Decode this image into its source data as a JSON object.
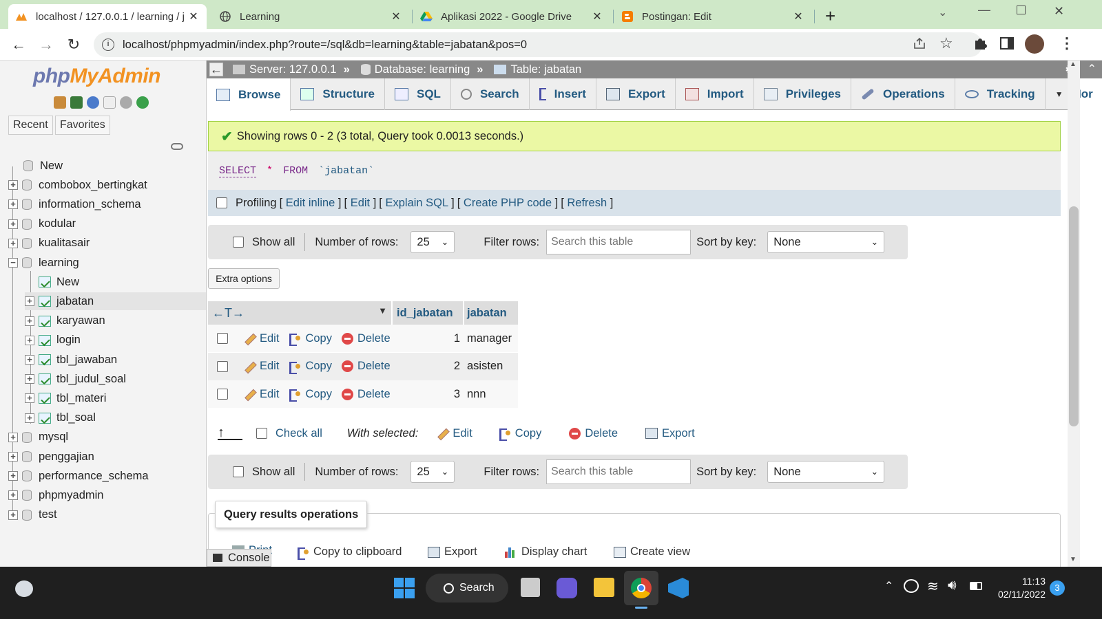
{
  "browser": {
    "tabs": [
      {
        "title": "localhost / 127.0.0.1 / learning / j",
        "active": true
      },
      {
        "title": "Learning",
        "active": false
      },
      {
        "title": "Aplikasi 2022 - Google Drive",
        "active": false
      },
      {
        "title": "Postingan: Edit",
        "active": false
      }
    ],
    "new_tab": "+",
    "url": "localhost/phpmyadmin/index.php?route=/sql&db=learning&table=jabatan&pos=0"
  },
  "sidebar": {
    "logo_php": "php",
    "logo_my": "MyAdmin",
    "recent": "Recent",
    "favorites": "Favorites",
    "tree": [
      {
        "label": "New",
        "type": "new",
        "level": 0
      },
      {
        "label": "combobox_bertingkat",
        "type": "db",
        "level": 0
      },
      {
        "label": "information_schema",
        "type": "db",
        "level": 0
      },
      {
        "label": "kodular",
        "type": "db",
        "level": 0
      },
      {
        "label": "kualitasair",
        "type": "db",
        "level": 0
      },
      {
        "label": "learning",
        "type": "db-open",
        "level": 0
      },
      {
        "label": "New",
        "type": "new",
        "level": 1
      },
      {
        "label": "jabatan",
        "type": "table",
        "level": 1,
        "selected": true
      },
      {
        "label": "karyawan",
        "type": "table",
        "level": 1
      },
      {
        "label": "login",
        "type": "table",
        "level": 1
      },
      {
        "label": "tbl_jawaban",
        "type": "table",
        "level": 1
      },
      {
        "label": "tbl_judul_soal",
        "type": "table",
        "level": 1
      },
      {
        "label": "tbl_materi",
        "type": "table",
        "level": 1
      },
      {
        "label": "tbl_soal",
        "type": "table",
        "level": 1
      },
      {
        "label": "mysql",
        "type": "db",
        "level": 0
      },
      {
        "label": "penggajian",
        "type": "db",
        "level": 0
      },
      {
        "label": "performance_schema",
        "type": "db",
        "level": 0
      },
      {
        "label": "phpmyadmin",
        "type": "db",
        "level": 0
      },
      {
        "label": "test",
        "type": "db",
        "level": 0
      }
    ]
  },
  "breadcrumb": {
    "server": "Server: 127.0.0.1",
    "database": "Database: learning",
    "table": "Table: jabatan"
  },
  "tabs": [
    "Browse",
    "Structure",
    "SQL",
    "Search",
    "Insert",
    "Export",
    "Import",
    "Privileges",
    "Operations",
    "Tracking",
    "Mor"
  ],
  "success_message": "Showing rows 0 - 2 (3 total, Query took 0.0013 seconds.)",
  "sql": {
    "kw1": "SELECT",
    "star": "*",
    "kw2": "FROM",
    "table": "`jabatan`"
  },
  "profiling": {
    "label": "Profiling",
    "links": [
      "Edit inline",
      "Edit",
      "Explain SQL",
      "Create PHP code",
      "Refresh"
    ]
  },
  "nav": {
    "show_all": "Show all",
    "num_rows_label": "Number of rows:",
    "num_rows_value": "25",
    "filter_label": "Filter rows:",
    "filter_placeholder": "Search this table",
    "sort_label": "Sort by key:",
    "sort_value": "None"
  },
  "extra_options": "Extra options",
  "table": {
    "columns": [
      "id_jabatan",
      "jabatan"
    ],
    "rows": [
      {
        "id_jabatan": "1",
        "jabatan": "manager"
      },
      {
        "id_jabatan": "2",
        "jabatan": "asisten"
      },
      {
        "id_jabatan": "3",
        "jabatan": "nnn"
      }
    ],
    "row_actions": {
      "edit": "Edit",
      "copy": "Copy",
      "delete": "Delete"
    }
  },
  "bulk": {
    "check_all": "Check all",
    "with_selected": "With selected:",
    "edit": "Edit",
    "copy": "Copy",
    "delete": "Delete",
    "export": "Export"
  },
  "query_results": {
    "legend": "Query results operations",
    "print": "Print",
    "copy_clipboard": "Copy to clipboard",
    "export": "Export",
    "display_chart": "Display chart",
    "create_view": "Create view"
  },
  "console": "Console",
  "taskbar": {
    "search": "Search",
    "time": "11:13",
    "date": "02/11/2022",
    "notifications": "3"
  }
}
